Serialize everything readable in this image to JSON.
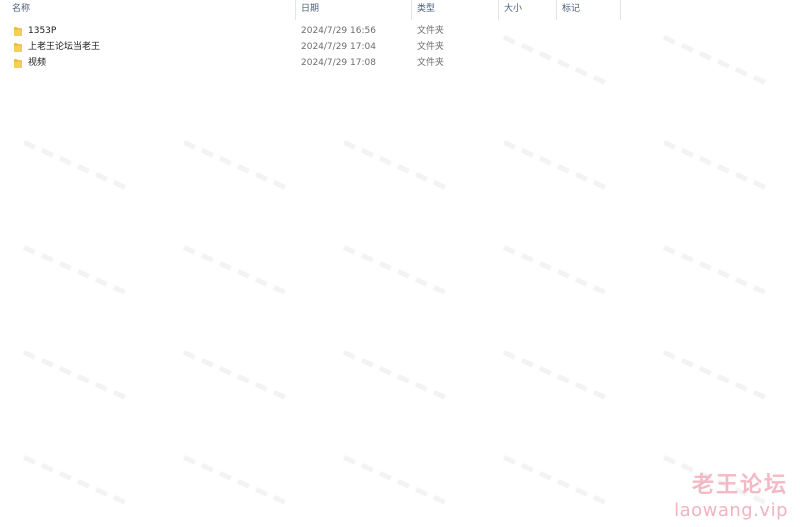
{
  "header": {
    "name": "名称",
    "date": "日期",
    "type": "类型",
    "size": "大小",
    "tag": "标记",
    "sort_arrow": "^"
  },
  "files": [
    {
      "name": "1353P",
      "date": "2024/7/29 16:56",
      "type": "文件夹",
      "icon": "folder-icon"
    },
    {
      "name": "上老王论坛当老王",
      "date": "2024/7/29 17:04",
      "type": "文件夹",
      "icon": "folder-icon"
    },
    {
      "name": "视频",
      "date": "2024/7/29 17:08",
      "type": "文件夹",
      "icon": "folder-icon"
    }
  ],
  "watermark": {
    "brand": "老王论坛",
    "url": "laowang.vip"
  },
  "colors": {
    "header_text": "#4c607a",
    "folder": "#e8b33a",
    "watermark": "#f1b3bf",
    "secondary_text": "#6d6d6d"
  }
}
